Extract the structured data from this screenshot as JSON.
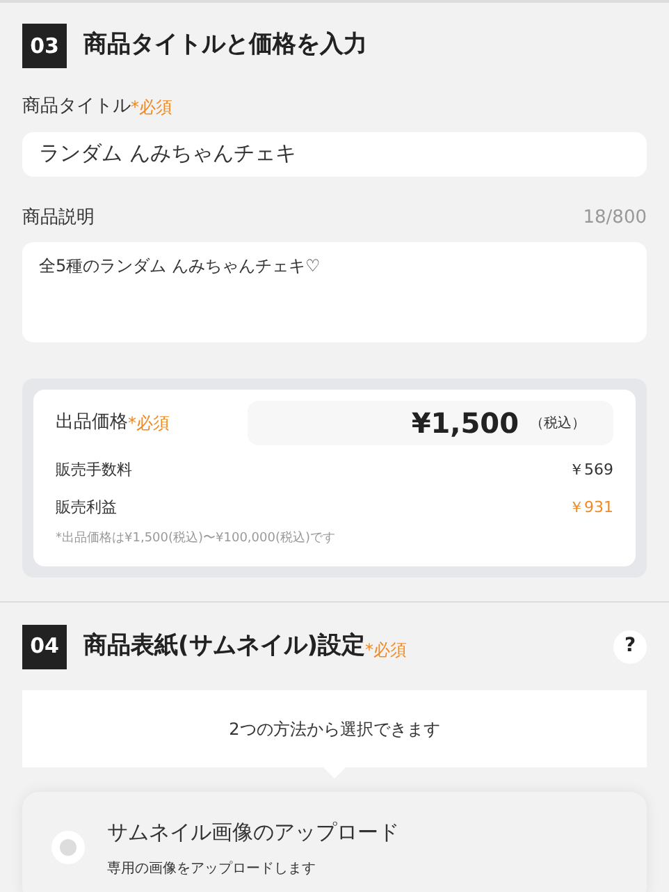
{
  "section_03": {
    "number": "03",
    "title": "商品タイトルと価格を入力",
    "title_field": {
      "label": "商品タイトル",
      "required": "*必須",
      "value": "ランダム んみちゃんチェキ"
    },
    "description_field": {
      "label": "商品説明",
      "counter": "18/800",
      "value": "全5種のランダム んみちゃんチェキ♡"
    },
    "price": {
      "label": "出品価格",
      "required": "*必須",
      "value": "¥1,500",
      "tax": "（税込）",
      "rows": [
        {
          "label": "販売手数料",
          "value": "￥569",
          "highlighted": false
        },
        {
          "label": "販売利益",
          "value": "￥931",
          "highlighted": true
        }
      ],
      "note": "*出品価格は¥1,500(税込)〜¥100,000(税込)です"
    }
  },
  "section_04": {
    "number": "04",
    "title": "商品表紙(サムネイル)設定",
    "required": "*必須",
    "help": "?",
    "info": "2つの方法から選択できます",
    "options": [
      {
        "title": "サムネイル画像のアップロード",
        "description": "専用の画像をアップロードします",
        "selected": false
      }
    ]
  }
}
